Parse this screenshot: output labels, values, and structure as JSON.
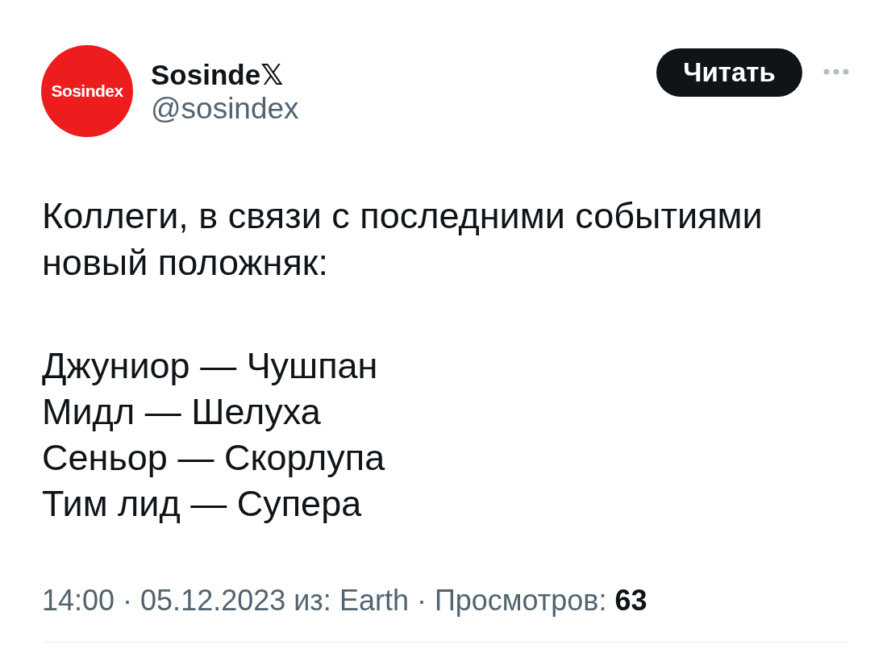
{
  "author": {
    "avatar_text": "Sosindex",
    "name": "Sosinde𝕏",
    "handle": "@sosindex"
  },
  "follow_button": {
    "label": "Читать"
  },
  "text": {
    "intro": "Коллеги, в связи с последними событиями новый положняк:",
    "lines": [
      "Джуниор — Чушпан",
      "Мидл — Шелуха",
      "Сеньор — Скорлупа",
      "Тим лид — Супера"
    ]
  },
  "meta": "14:00 · 05.12.2023 из: Earth · Просмотров: **63**"
}
